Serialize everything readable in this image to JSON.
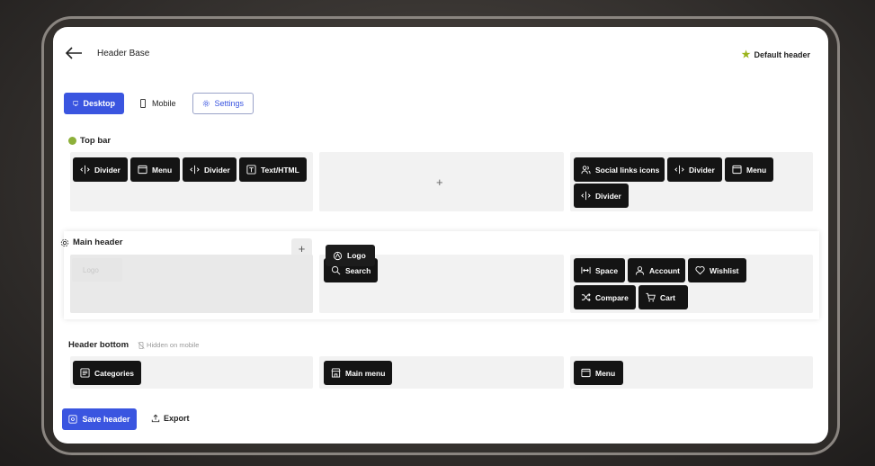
{
  "header": {
    "title": "Header Base",
    "badge": "Default header"
  },
  "tabs": [
    {
      "label": "Desktop",
      "icon": "monitor-icon"
    },
    {
      "label": "Mobile",
      "icon": "phone-icon"
    },
    {
      "label": "Settings",
      "icon": "gear-icon"
    }
  ],
  "top_bar": {
    "label": "Top bar",
    "left": [
      "Divider",
      "Menu",
      "Divider",
      "Text/HTML"
    ],
    "right": [
      "Social links icons",
      "Divider",
      "Menu",
      "Divider"
    ]
  },
  "main_header": {
    "label": "Main header",
    "ghost": "Logo",
    "dragging": "Logo",
    "center": [
      "Search"
    ],
    "right": [
      "Space",
      "Account",
      "Wishlist",
      "Compare",
      "Cart"
    ]
  },
  "header_bottom": {
    "label": "Header bottom",
    "note": "Hidden on mobile",
    "left": [
      "Categories"
    ],
    "center": [
      "Main menu"
    ],
    "right": [
      "Menu"
    ]
  },
  "footer": {
    "save_label": "Save header",
    "export_label": "Export"
  },
  "colors": {
    "accent": "#3a55e0",
    "chip": "#141414",
    "zone": "#f2f2f2"
  }
}
